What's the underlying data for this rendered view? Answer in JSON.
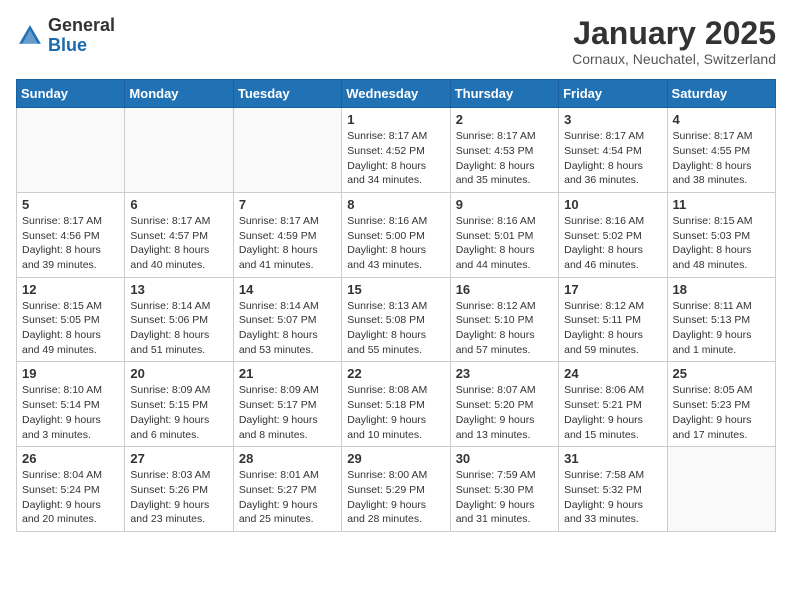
{
  "header": {
    "logo_general": "General",
    "logo_blue": "Blue",
    "month_title": "January 2025",
    "location": "Cornaux, Neuchatel, Switzerland"
  },
  "weekdays": [
    "Sunday",
    "Monday",
    "Tuesday",
    "Wednesday",
    "Thursday",
    "Friday",
    "Saturday"
  ],
  "weeks": [
    [
      {
        "day": "",
        "info": ""
      },
      {
        "day": "",
        "info": ""
      },
      {
        "day": "",
        "info": ""
      },
      {
        "day": "1",
        "info": "Sunrise: 8:17 AM\nSunset: 4:52 PM\nDaylight: 8 hours\nand 34 minutes."
      },
      {
        "day": "2",
        "info": "Sunrise: 8:17 AM\nSunset: 4:53 PM\nDaylight: 8 hours\nand 35 minutes."
      },
      {
        "day": "3",
        "info": "Sunrise: 8:17 AM\nSunset: 4:54 PM\nDaylight: 8 hours\nand 36 minutes."
      },
      {
        "day": "4",
        "info": "Sunrise: 8:17 AM\nSunset: 4:55 PM\nDaylight: 8 hours\nand 38 minutes."
      }
    ],
    [
      {
        "day": "5",
        "info": "Sunrise: 8:17 AM\nSunset: 4:56 PM\nDaylight: 8 hours\nand 39 minutes."
      },
      {
        "day": "6",
        "info": "Sunrise: 8:17 AM\nSunset: 4:57 PM\nDaylight: 8 hours\nand 40 minutes."
      },
      {
        "day": "7",
        "info": "Sunrise: 8:17 AM\nSunset: 4:59 PM\nDaylight: 8 hours\nand 41 minutes."
      },
      {
        "day": "8",
        "info": "Sunrise: 8:16 AM\nSunset: 5:00 PM\nDaylight: 8 hours\nand 43 minutes."
      },
      {
        "day": "9",
        "info": "Sunrise: 8:16 AM\nSunset: 5:01 PM\nDaylight: 8 hours\nand 44 minutes."
      },
      {
        "day": "10",
        "info": "Sunrise: 8:16 AM\nSunset: 5:02 PM\nDaylight: 8 hours\nand 46 minutes."
      },
      {
        "day": "11",
        "info": "Sunrise: 8:15 AM\nSunset: 5:03 PM\nDaylight: 8 hours\nand 48 minutes."
      }
    ],
    [
      {
        "day": "12",
        "info": "Sunrise: 8:15 AM\nSunset: 5:05 PM\nDaylight: 8 hours\nand 49 minutes."
      },
      {
        "day": "13",
        "info": "Sunrise: 8:14 AM\nSunset: 5:06 PM\nDaylight: 8 hours\nand 51 minutes."
      },
      {
        "day": "14",
        "info": "Sunrise: 8:14 AM\nSunset: 5:07 PM\nDaylight: 8 hours\nand 53 minutes."
      },
      {
        "day": "15",
        "info": "Sunrise: 8:13 AM\nSunset: 5:08 PM\nDaylight: 8 hours\nand 55 minutes."
      },
      {
        "day": "16",
        "info": "Sunrise: 8:12 AM\nSunset: 5:10 PM\nDaylight: 8 hours\nand 57 minutes."
      },
      {
        "day": "17",
        "info": "Sunrise: 8:12 AM\nSunset: 5:11 PM\nDaylight: 8 hours\nand 59 minutes."
      },
      {
        "day": "18",
        "info": "Sunrise: 8:11 AM\nSunset: 5:13 PM\nDaylight: 9 hours\nand 1 minute."
      }
    ],
    [
      {
        "day": "19",
        "info": "Sunrise: 8:10 AM\nSunset: 5:14 PM\nDaylight: 9 hours\nand 3 minutes."
      },
      {
        "day": "20",
        "info": "Sunrise: 8:09 AM\nSunset: 5:15 PM\nDaylight: 9 hours\nand 6 minutes."
      },
      {
        "day": "21",
        "info": "Sunrise: 8:09 AM\nSunset: 5:17 PM\nDaylight: 9 hours\nand 8 minutes."
      },
      {
        "day": "22",
        "info": "Sunrise: 8:08 AM\nSunset: 5:18 PM\nDaylight: 9 hours\nand 10 minutes."
      },
      {
        "day": "23",
        "info": "Sunrise: 8:07 AM\nSunset: 5:20 PM\nDaylight: 9 hours\nand 13 minutes."
      },
      {
        "day": "24",
        "info": "Sunrise: 8:06 AM\nSunset: 5:21 PM\nDaylight: 9 hours\nand 15 minutes."
      },
      {
        "day": "25",
        "info": "Sunrise: 8:05 AM\nSunset: 5:23 PM\nDaylight: 9 hours\nand 17 minutes."
      }
    ],
    [
      {
        "day": "26",
        "info": "Sunrise: 8:04 AM\nSunset: 5:24 PM\nDaylight: 9 hours\nand 20 minutes."
      },
      {
        "day": "27",
        "info": "Sunrise: 8:03 AM\nSunset: 5:26 PM\nDaylight: 9 hours\nand 23 minutes."
      },
      {
        "day": "28",
        "info": "Sunrise: 8:01 AM\nSunset: 5:27 PM\nDaylight: 9 hours\nand 25 minutes."
      },
      {
        "day": "29",
        "info": "Sunrise: 8:00 AM\nSunset: 5:29 PM\nDaylight: 9 hours\nand 28 minutes."
      },
      {
        "day": "30",
        "info": "Sunrise: 7:59 AM\nSunset: 5:30 PM\nDaylight: 9 hours\nand 31 minutes."
      },
      {
        "day": "31",
        "info": "Sunrise: 7:58 AM\nSunset: 5:32 PM\nDaylight: 9 hours\nand 33 minutes."
      },
      {
        "day": "",
        "info": ""
      }
    ]
  ]
}
